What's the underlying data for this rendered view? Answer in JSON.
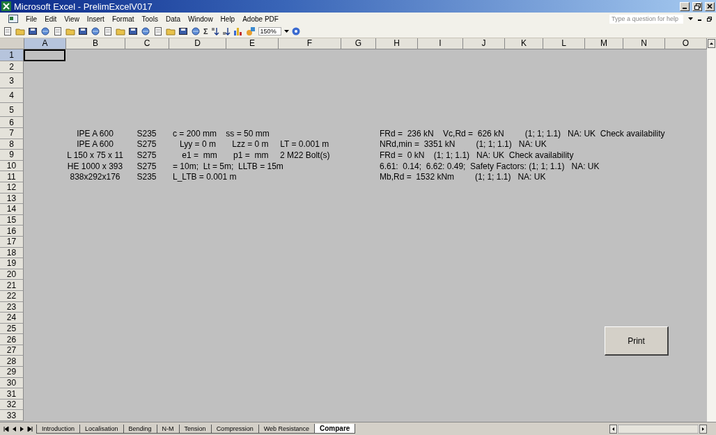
{
  "window": {
    "title": "Microsoft Excel - PrelimExcelV017"
  },
  "menu": [
    {
      "label": "File"
    },
    {
      "label": "Edit"
    },
    {
      "label": "View"
    },
    {
      "label": "Insert"
    },
    {
      "label": "Format"
    },
    {
      "label": "Tools"
    },
    {
      "label": "Data"
    },
    {
      "label": "Window"
    },
    {
      "label": "Help"
    },
    {
      "label": "Adobe PDF"
    }
  ],
  "help_box": {
    "placeholder": "Type a question for help"
  },
  "toolbar": {
    "autosum": "Σ",
    "zoom": "150%"
  },
  "columns": [
    {
      "label": "A",
      "selected": true
    },
    {
      "label": "B",
      "selected": false
    },
    {
      "label": "C",
      "selected": false
    },
    {
      "label": "D",
      "selected": false
    },
    {
      "label": "E",
      "selected": false
    },
    {
      "label": "F",
      "selected": false
    },
    {
      "label": "G",
      "selected": false
    },
    {
      "label": "H",
      "selected": false
    },
    {
      "label": "I",
      "selected": false
    },
    {
      "label": "J",
      "selected": false
    },
    {
      "label": "K",
      "selected": false
    },
    {
      "label": "L",
      "selected": false
    },
    {
      "label": "M",
      "selected": false
    },
    {
      "label": "N",
      "selected": false
    },
    {
      "label": "O",
      "selected": false
    }
  ],
  "rows": [
    {
      "label": "1",
      "selected": true
    },
    {
      "label": "2",
      "selected": false
    },
    {
      "label": "3",
      "selected": false
    },
    {
      "label": "4",
      "selected": false
    },
    {
      "label": "5",
      "selected": false
    },
    {
      "label": "6",
      "selected": false
    },
    {
      "label": "7",
      "selected": false,
      "cells": {
        "section": "IPE A 600",
        "grade": "S235",
        "geometry": "c = 200 mm    ss = 50 mm",
        "result": "FRd =  236 kN    Vc,Rd =  626 kN         (1; 1; 1.1)   NA: UK  Check availability"
      }
    },
    {
      "label": "8",
      "selected": false,
      "cells": {
        "section": "IPE A 600",
        "grade": "S275",
        "geometry": "   Lyy = 0 m       Lzz = 0 m     LT = 0.001 m",
        "result": "NRd,min =  3351 kN         (1; 1; 1.1)   NA: UK"
      }
    },
    {
      "label": "9",
      "selected": false,
      "cells": {
        "section": "L 150 x 75 x 11",
        "grade": "S275",
        "geometry": "    e1 =  mm       p1 =  mm     2 M22 Bolt(s)",
        "result": "FRd =  0 kN    (1; 1; 1.1)   NA: UK  Check availability"
      }
    },
    {
      "label": "10",
      "selected": false,
      "cells": {
        "section": "HE 1000 x 393",
        "grade": "S275",
        "geometry": "= 10m;  Lt = 5m;  LLTB = 15m",
        "result": "6.61:  0.14;  6.62: 0.49;  Safety Factors: (1; 1; 1.1)   NA: UK"
      }
    },
    {
      "label": "11",
      "selected": false,
      "cells": {
        "section": "838x292x176",
        "grade": "S235",
        "geometry": "L_LTB = 0.001 m",
        "result": "Mb,Rd =  1532 kNm         (1; 1; 1.1)   NA: UK"
      }
    },
    {
      "label": "12",
      "selected": false
    },
    {
      "label": "13",
      "selected": false
    },
    {
      "label": "14",
      "selected": false
    },
    {
      "label": "15",
      "selected": false
    },
    {
      "label": "16",
      "selected": false
    },
    {
      "label": "17",
      "selected": false
    },
    {
      "label": "18",
      "selected": false
    },
    {
      "label": "19",
      "selected": false
    },
    {
      "label": "20",
      "selected": false
    },
    {
      "label": "21",
      "selected": false
    },
    {
      "label": "22",
      "selected": false
    },
    {
      "label": "23",
      "selected": false
    },
    {
      "label": "24",
      "selected": false
    },
    {
      "label": "25",
      "selected": false
    },
    {
      "label": "26",
      "selected": false
    },
    {
      "label": "27",
      "selected": false
    },
    {
      "label": "28",
      "selected": false
    },
    {
      "label": "29",
      "selected": false
    },
    {
      "label": "30",
      "selected": false
    },
    {
      "label": "31",
      "selected": false
    },
    {
      "label": "32",
      "selected": false
    },
    {
      "label": "33",
      "selected": false
    }
  ],
  "print_button": {
    "label": "Print"
  },
  "sheet_tabs": [
    {
      "label": "Introduction",
      "selected": false
    },
    {
      "label": "Localisation",
      "selected": false
    },
    {
      "label": "Bending",
      "selected": false
    },
    {
      "label": "N-M",
      "selected": false
    },
    {
      "label": "Tension",
      "selected": false
    },
    {
      "label": "Compression",
      "selected": false
    },
    {
      "label": "Web Resistance",
      "selected": false
    },
    {
      "label": "Compare",
      "selected": true
    }
  ]
}
